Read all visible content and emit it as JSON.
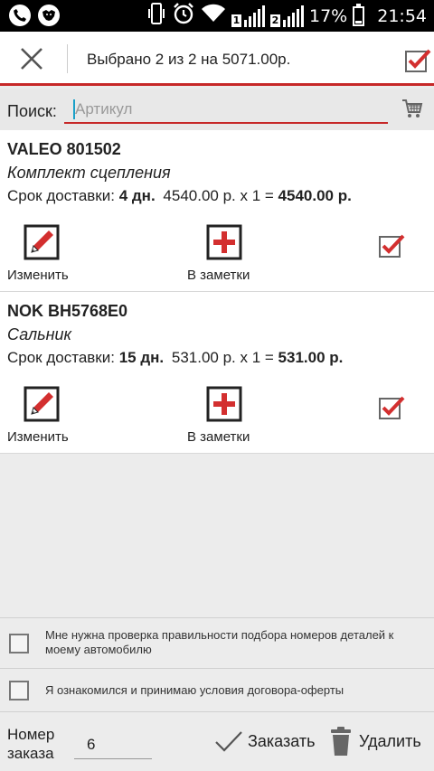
{
  "status_bar": {
    "sim1": "1",
    "sim2": "2",
    "battery": "17%",
    "time": "21:54",
    "icons": [
      "phone-icon",
      "lion-app-icon",
      "vibrate-icon",
      "alarm-icon",
      "wifi-icon",
      "signal-icon",
      "battery-icon"
    ]
  },
  "action_bar": {
    "title": "Выбрано 2 из 2 на 5071.00р.",
    "close_icon": "close-icon",
    "select_all_checked": true
  },
  "search": {
    "label": "Поиск:",
    "placeholder": "Артикул",
    "value": ""
  },
  "items": [
    {
      "title": "VALEO  801502",
      "description": "Комплект сцепления",
      "delivery_label": "Срок доставки:",
      "delivery_days": "4 дн.",
      "price_calc": "4540.00 р. х 1 =",
      "total": "4540.00 р.",
      "edit_label": "Изменить",
      "note_label": "В заметки",
      "checked": true
    },
    {
      "title": "NOK  BH5768E0",
      "description": "Сальник",
      "delivery_label": "Срок доставки:",
      "delivery_days": "15 дн.",
      "price_calc": "531.00 р. х 1 =",
      "total": "531.00 р.",
      "edit_label": "Изменить",
      "note_label": "В заметки",
      "checked": true
    }
  ],
  "agreements": [
    {
      "text": "Мне нужна проверка правильности подбора номеров деталей к моему автомобилю",
      "checked": false
    },
    {
      "text": "Я ознакомился и принимаю условия договора-оферты",
      "checked": false
    }
  ],
  "footer": {
    "order_label": "Номер заказа",
    "order_value": "6",
    "order_button": "Заказать",
    "delete_button": "Удалить"
  },
  "colors": {
    "accent": "#c62828",
    "background": "#ececec",
    "caret": "#1aa0c8"
  }
}
